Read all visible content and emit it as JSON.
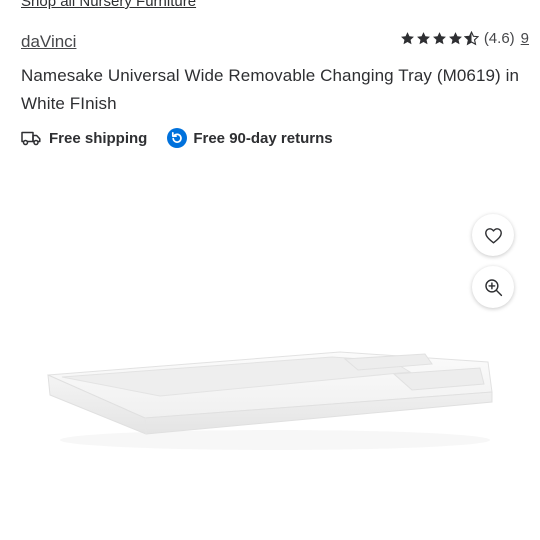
{
  "breadcrumb": {
    "shop_all_label": "Shop all Nursery Furniture"
  },
  "product": {
    "brand": "daVinci",
    "title": "Namesake Universal Wide Removable Changing Tray (M0619) in White FInish",
    "rating": {
      "stars": 4.5,
      "max_stars": 5,
      "value_label": "(4.6)",
      "review_count": "9"
    }
  },
  "badges": {
    "shipping": {
      "icon": "truck-icon",
      "label": "Free shipping"
    },
    "returns": {
      "icon": "return-arrow-icon",
      "label": "Free 90-day returns",
      "icon_color": "#0071dc"
    }
  },
  "gallery": {
    "favorite_icon": "heart-icon",
    "zoom_icon": "zoom-in-icon"
  }
}
